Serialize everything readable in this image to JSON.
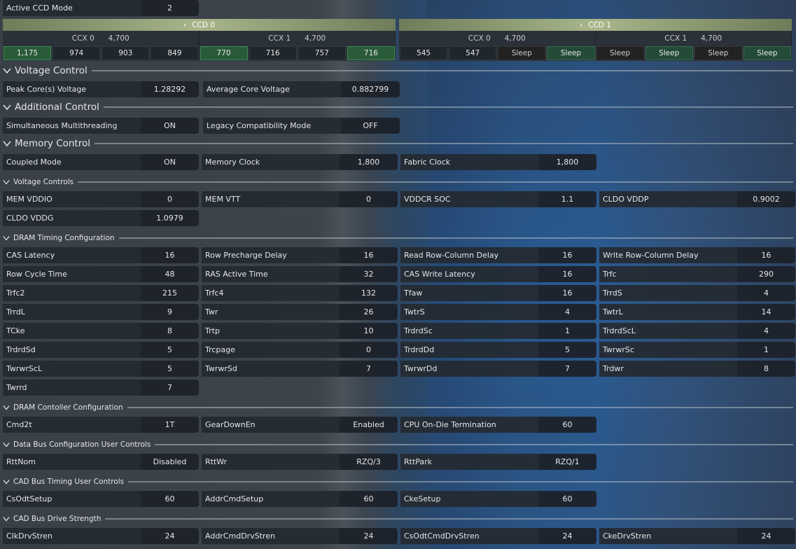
{
  "active_ccd": {
    "label": "Active CCD Mode",
    "value": "2"
  },
  "ccds": [
    {
      "name": "CCD 0",
      "ccxs": [
        {
          "name": "CCX 0",
          "freq": "4,700",
          "cores": [
            "1,175",
            "974",
            "903",
            "849"
          ],
          "states": [
            "hi",
            "",
            "",
            ""
          ]
        },
        {
          "name": "CCX 1",
          "freq": "4,700",
          "cores": [
            "770",
            "716",
            "757",
            "716"
          ],
          "states": [
            "hi",
            "",
            "",
            "hi"
          ]
        }
      ]
    },
    {
      "name": "CCD 1",
      "ccxs": [
        {
          "name": "CCX 0",
          "freq": "4,700",
          "cores": [
            "545",
            "547",
            "Sleep",
            "Sleep"
          ],
          "states": [
            "",
            "",
            "sleep",
            "sleephi"
          ]
        },
        {
          "name": "CCX 1",
          "freq": "4,700",
          "cores": [
            "Sleep",
            "Sleep",
            "Sleep",
            "Sleep"
          ],
          "states": [
            "sleep",
            "sleephi",
            "sleep",
            "sleephi"
          ]
        }
      ]
    }
  ],
  "sections": {
    "voltage_control": "Voltage Control",
    "additional_control": "Additional Control",
    "memory_control": "Memory Control",
    "voltage_controls": "Voltage Controls",
    "dram_timing": "DRAM Timing Configuration",
    "dram_controller": "DRAM Contoller Configuration",
    "data_bus": "Data Bus Configuration User Controls",
    "cad_timing": "CAD Bus Timing User Controls",
    "cad_drive": "CAD Bus Drive Strength"
  },
  "voltage": [
    {
      "label": "Peak Core(s) Voltage",
      "value": "1.28292"
    },
    {
      "label": "Average Core Voltage",
      "value": "0.882799"
    }
  ],
  "additional": [
    {
      "label": "Simultaneous Multithreading",
      "value": "ON"
    },
    {
      "label": "Legacy Compatibility Mode",
      "value": "OFF"
    }
  ],
  "memory": [
    {
      "label": "Coupled Mode",
      "value": "ON"
    },
    {
      "label": "Memory Clock",
      "value": "1,800"
    },
    {
      "label": "Fabric Clock",
      "value": "1,800"
    }
  ],
  "mem_voltages": [
    {
      "label": "MEM VDDIO",
      "value": "0"
    },
    {
      "label": "MEM VTT",
      "value": "0"
    },
    {
      "label": "VDDCR SOC",
      "value": "1.1"
    },
    {
      "label": "CLDO VDDP",
      "value": "0.9002"
    },
    {
      "label": "CLDO VDDG",
      "value": "1.0979"
    }
  ],
  "timings": [
    {
      "label": "CAS Latency",
      "value": "16"
    },
    {
      "label": "Row Precharge Delay",
      "value": "16"
    },
    {
      "label": "Read Row-Column Delay",
      "value": "16"
    },
    {
      "label": "Write Row-Column Delay",
      "value": "16"
    },
    {
      "label": "Row Cycle Time",
      "value": "48"
    },
    {
      "label": "RAS Active Time",
      "value": "32"
    },
    {
      "label": "CAS Write Latency",
      "value": "16"
    },
    {
      "label": "Trfc",
      "value": "290"
    },
    {
      "label": "Trfc2",
      "value": "215"
    },
    {
      "label": "Trfc4",
      "value": "132"
    },
    {
      "label": "Tfaw",
      "value": "16"
    },
    {
      "label": "TrrdS",
      "value": "4"
    },
    {
      "label": "TrrdL",
      "value": "9"
    },
    {
      "label": "Twr",
      "value": "26"
    },
    {
      "label": "TwtrS",
      "value": "4"
    },
    {
      "label": "TwtrL",
      "value": "14"
    },
    {
      "label": "TCke",
      "value": "8"
    },
    {
      "label": "Trtp",
      "value": "10"
    },
    {
      "label": "TrdrdSc",
      "value": "1"
    },
    {
      "label": "TrdrdScL",
      "value": "4"
    },
    {
      "label": "TrdrdSd",
      "value": "5"
    },
    {
      "label": "Trcpage",
      "value": "0"
    },
    {
      "label": "TrdrdDd",
      "value": "5"
    },
    {
      "label": "TwrwrSc",
      "value": "1"
    },
    {
      "label": "TwrwrScL",
      "value": "5"
    },
    {
      "label": "TwrwrSd",
      "value": "7"
    },
    {
      "label": "TwrwrDd",
      "value": "7"
    },
    {
      "label": "Trdwr",
      "value": "8"
    },
    {
      "label": "Twrrd",
      "value": "7"
    }
  ],
  "controller": [
    {
      "label": "Cmd2t",
      "value": "1T"
    },
    {
      "label": "GearDownEn",
      "value": "Enabled"
    },
    {
      "label": "CPU On-Die Termination",
      "value": "60"
    }
  ],
  "databus": [
    {
      "label": "RttNom",
      "value": "Disabled"
    },
    {
      "label": "RttWr",
      "value": "RZQ/3"
    },
    {
      "label": "RttPark",
      "value": "RZQ/1"
    }
  ],
  "cadtiming": [
    {
      "label": "CsOdtSetup",
      "value": "60"
    },
    {
      "label": "AddrCmdSetup",
      "value": "60"
    },
    {
      "label": "CkeSetup",
      "value": "60"
    }
  ],
  "caddrive": [
    {
      "label": "ClkDrvStren",
      "value": "24"
    },
    {
      "label": "AddrCmdDrvStren",
      "value": "24"
    },
    {
      "label": "CsOdtCmdDrvStren",
      "value": "24"
    },
    {
      "label": "CkeDrvStren",
      "value": "24"
    }
  ]
}
